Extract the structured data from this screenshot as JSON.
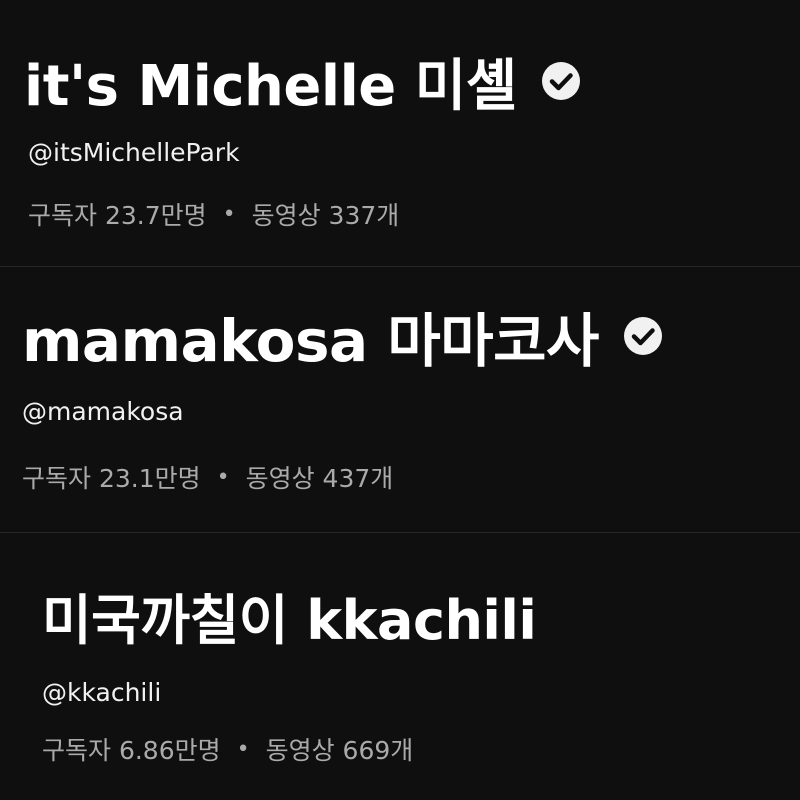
{
  "channels": [
    {
      "name": "it's Michelle 미셸",
      "handle": "@itsMichellePark",
      "subscribers": "구독자 23.7만명",
      "separator": "•",
      "videos": "동영상 337개",
      "verified": true
    },
    {
      "name": "mamakosa 마마코사",
      "handle": "@mamakosa",
      "subscribers": "구독자 23.1만명",
      "separator": "•",
      "videos": "동영상 437개",
      "verified": true
    },
    {
      "name": "미국까칠이 kkachili",
      "handle": "@kkachili",
      "subscribers": "구독자 6.86만명",
      "separator": "•",
      "videos": "동영상 669개",
      "verified": false
    }
  ],
  "icons": {
    "verified": "check-circle-icon"
  },
  "colors": {
    "background": "#0f0f0f",
    "title": "#ffffff",
    "secondary": "#aaaaaa",
    "divider": "#262626"
  }
}
